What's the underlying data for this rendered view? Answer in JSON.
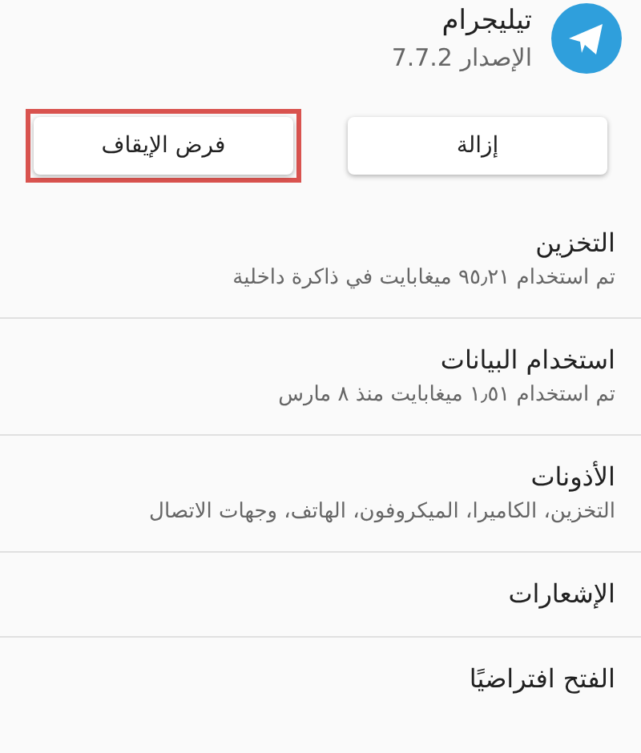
{
  "app": {
    "name": "تيليجرام",
    "version": "الإصدار 7.7.2"
  },
  "buttons": [
    {
      "label": "إزالة",
      "highlighted": false
    },
    {
      "label": "فرض الإيقاف",
      "highlighted": true
    }
  ],
  "settings": [
    {
      "title": "التخزين",
      "subtitle": "تم استخدام ٩٥٫٢١ ميغابايت في ذاكرة داخلية"
    },
    {
      "title": "استخدام البيانات",
      "subtitle": "تم استخدام ١٫٥١ ميغابايت منذ ٨ مارس"
    },
    {
      "title": "الأذونات",
      "subtitle": "التخزين، الكاميرا، الميكروفون، الهاتف، وجهات الاتصال"
    },
    {
      "title": "الإشعارات"
    },
    {
      "title": "الفتح افتراضيًا"
    }
  ]
}
